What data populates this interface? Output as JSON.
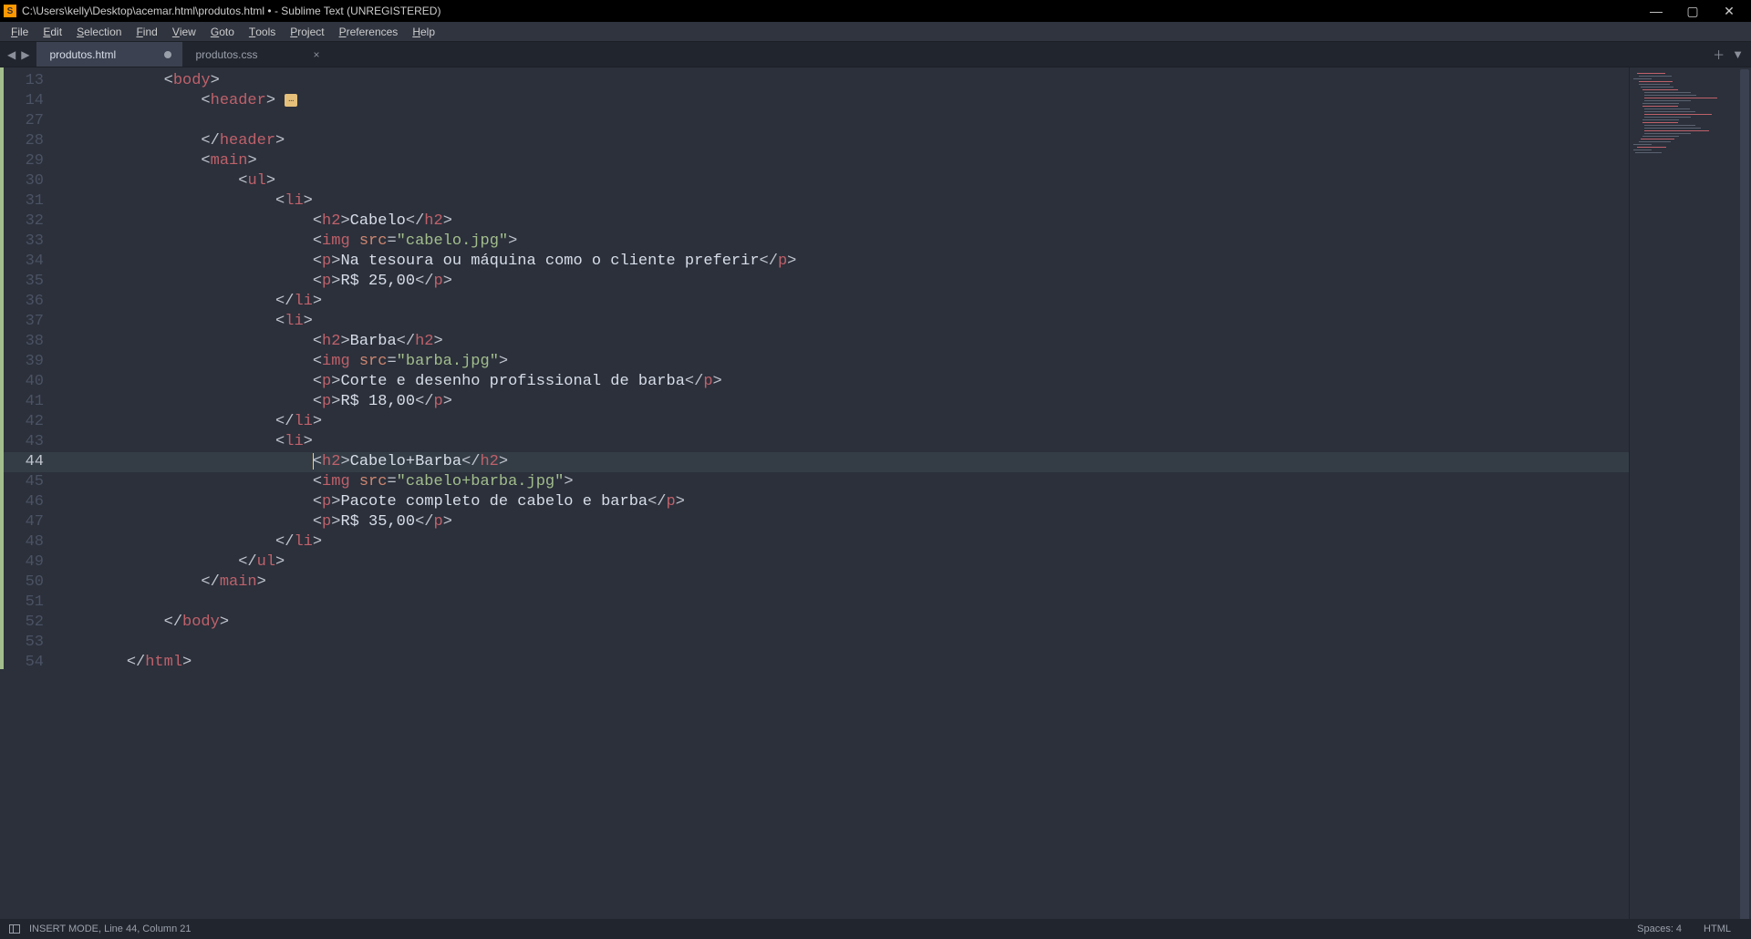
{
  "window": {
    "title": "C:\\Users\\kelly\\Desktop\\acemar.html\\produtos.html • - Sublime Text (UNREGISTERED)"
  },
  "menu": {
    "items": [
      "File",
      "Edit",
      "Selection",
      "Find",
      "View",
      "Goto",
      "Tools",
      "Project",
      "Preferences",
      "Help"
    ]
  },
  "tabs": [
    {
      "label": "produtos.html",
      "active": true,
      "dirty": true
    },
    {
      "label": "produtos.css",
      "active": false,
      "dirty": false
    }
  ],
  "status": {
    "mode": "INSERT MODE, Line 44, Column 21",
    "spaces": "Spaces: 4",
    "syntax": "HTML"
  },
  "editor": {
    "fold_marker": "…",
    "lines": [
      {
        "n": 13,
        "indent": 2,
        "tokens": [
          [
            "pun",
            "<"
          ],
          [
            "tag",
            "body"
          ],
          [
            "pun",
            ">"
          ]
        ]
      },
      {
        "n": 14,
        "indent": 3,
        "tokens": [
          [
            "pun",
            "<"
          ],
          [
            "tag",
            "header"
          ],
          [
            "pun",
            ">"
          ],
          [
            "fold",
            ""
          ]
        ]
      },
      {
        "n": 27,
        "indent": 0,
        "tokens": []
      },
      {
        "n": 28,
        "indent": 3,
        "tokens": [
          [
            "pun",
            "</"
          ],
          [
            "tag",
            "header"
          ],
          [
            "pun",
            ">"
          ]
        ]
      },
      {
        "n": 29,
        "indent": 3,
        "tokens": [
          [
            "pun",
            "<"
          ],
          [
            "tag",
            "main"
          ],
          [
            "pun",
            ">"
          ]
        ]
      },
      {
        "n": 30,
        "indent": 4,
        "tokens": [
          [
            "pun",
            "<"
          ],
          [
            "tag",
            "ul"
          ],
          [
            "pun",
            ">"
          ]
        ]
      },
      {
        "n": 31,
        "indent": 5,
        "tokens": [
          [
            "pun",
            "<"
          ],
          [
            "tag",
            "li"
          ],
          [
            "pun",
            ">"
          ]
        ]
      },
      {
        "n": 32,
        "indent": 6,
        "tokens": [
          [
            "pun",
            "<"
          ],
          [
            "tag",
            "h2"
          ],
          [
            "pun",
            ">"
          ],
          [
            "txt",
            "Cabelo"
          ],
          [
            "pun",
            "</"
          ],
          [
            "tag",
            "h2"
          ],
          [
            "pun",
            ">"
          ]
        ]
      },
      {
        "n": 33,
        "indent": 6,
        "tokens": [
          [
            "pun",
            "<"
          ],
          [
            "tag",
            "img"
          ],
          [
            "txt",
            " "
          ],
          [
            "attr",
            "src"
          ],
          [
            "op",
            "="
          ],
          [
            "str",
            "\"cabelo.jpg\""
          ],
          [
            "pun",
            ">"
          ]
        ]
      },
      {
        "n": 34,
        "indent": 6,
        "tokens": [
          [
            "pun",
            "<"
          ],
          [
            "tag",
            "p"
          ],
          [
            "pun",
            ">"
          ],
          [
            "txt",
            "Na tesoura ou máquina como o cliente preferir"
          ],
          [
            "pun",
            "</"
          ],
          [
            "tag",
            "p"
          ],
          [
            "pun",
            ">"
          ]
        ]
      },
      {
        "n": 35,
        "indent": 6,
        "tokens": [
          [
            "pun",
            "<"
          ],
          [
            "tag",
            "p"
          ],
          [
            "pun",
            ">"
          ],
          [
            "txt",
            "R$ 25,00"
          ],
          [
            "pun",
            "</"
          ],
          [
            "tag",
            "p"
          ],
          [
            "pun",
            ">"
          ]
        ]
      },
      {
        "n": 36,
        "indent": 5,
        "tokens": [
          [
            "pun",
            "</"
          ],
          [
            "tag",
            "li"
          ],
          [
            "pun",
            ">"
          ]
        ]
      },
      {
        "n": 37,
        "indent": 5,
        "tokens": [
          [
            "pun",
            "<"
          ],
          [
            "tag",
            "li"
          ],
          [
            "pun",
            ">"
          ]
        ]
      },
      {
        "n": 38,
        "indent": 6,
        "tokens": [
          [
            "pun",
            "<"
          ],
          [
            "tag",
            "h2"
          ],
          [
            "pun",
            ">"
          ],
          [
            "txt",
            "Barba"
          ],
          [
            "pun",
            "</"
          ],
          [
            "tag",
            "h2"
          ],
          [
            "pun",
            ">"
          ]
        ]
      },
      {
        "n": 39,
        "indent": 6,
        "tokens": [
          [
            "pun",
            "<"
          ],
          [
            "tag",
            "img"
          ],
          [
            "txt",
            " "
          ],
          [
            "attr",
            "src"
          ],
          [
            "op",
            "="
          ],
          [
            "str",
            "\"barba.jpg\""
          ],
          [
            "pun",
            ">"
          ]
        ]
      },
      {
        "n": 40,
        "indent": 6,
        "tokens": [
          [
            "pun",
            "<"
          ],
          [
            "tag",
            "p"
          ],
          [
            "pun",
            ">"
          ],
          [
            "txt",
            "Corte e desenho profissional de barba"
          ],
          [
            "pun",
            "</"
          ],
          [
            "tag",
            "p"
          ],
          [
            "pun",
            ">"
          ]
        ]
      },
      {
        "n": 41,
        "indent": 6,
        "tokens": [
          [
            "pun",
            "<"
          ],
          [
            "tag",
            "p"
          ],
          [
            "pun",
            ">"
          ],
          [
            "txt",
            "R$ 18,00"
          ],
          [
            "pun",
            "</"
          ],
          [
            "tag",
            "p"
          ],
          [
            "pun",
            ">"
          ]
        ]
      },
      {
        "n": 42,
        "indent": 5,
        "tokens": [
          [
            "pun",
            "</"
          ],
          [
            "tag",
            "li"
          ],
          [
            "pun",
            ">"
          ]
        ]
      },
      {
        "n": 43,
        "indent": 5,
        "tokens": [
          [
            "pun",
            "<"
          ],
          [
            "tag",
            "li"
          ],
          [
            "pun",
            ">"
          ]
        ]
      },
      {
        "n": 44,
        "indent": 6,
        "tokens": [
          [
            "caret",
            ""
          ],
          [
            "pun",
            "<"
          ],
          [
            "tag",
            "h2"
          ],
          [
            "pun",
            ">"
          ],
          [
            "txt",
            "Cabelo+Barba"
          ],
          [
            "pun",
            "</"
          ],
          [
            "tag",
            "h2"
          ],
          [
            "pun",
            ">"
          ]
        ],
        "current": true
      },
      {
        "n": 45,
        "indent": 6,
        "tokens": [
          [
            "pun",
            "<"
          ],
          [
            "tag",
            "img"
          ],
          [
            "txt",
            " "
          ],
          [
            "attr",
            "src"
          ],
          [
            "op",
            "="
          ],
          [
            "str",
            "\"cabelo+barba.jpg\""
          ],
          [
            "pun",
            ">"
          ]
        ]
      },
      {
        "n": 46,
        "indent": 6,
        "tokens": [
          [
            "pun",
            "<"
          ],
          [
            "tag",
            "p"
          ],
          [
            "pun",
            ">"
          ],
          [
            "txt",
            "Pacote completo de cabelo e barba"
          ],
          [
            "pun",
            "</"
          ],
          [
            "tag",
            "p"
          ],
          [
            "pun",
            ">"
          ]
        ]
      },
      {
        "n": 47,
        "indent": 6,
        "tokens": [
          [
            "pun",
            "<"
          ],
          [
            "tag",
            "p"
          ],
          [
            "pun",
            ">"
          ],
          [
            "txt",
            "R$ 35,00"
          ],
          [
            "pun",
            "</"
          ],
          [
            "tag",
            "p"
          ],
          [
            "pun",
            ">"
          ]
        ]
      },
      {
        "n": 48,
        "indent": 5,
        "tokens": [
          [
            "pun",
            "</"
          ],
          [
            "tag",
            "li"
          ],
          [
            "pun",
            ">"
          ]
        ]
      },
      {
        "n": 49,
        "indent": 4,
        "tokens": [
          [
            "pun",
            "</"
          ],
          [
            "tag",
            "ul"
          ],
          [
            "pun",
            ">"
          ]
        ]
      },
      {
        "n": 50,
        "indent": 3,
        "tokens": [
          [
            "pun",
            "</"
          ],
          [
            "tag",
            "main"
          ],
          [
            "pun",
            ">"
          ]
        ]
      },
      {
        "n": 51,
        "indent": 0,
        "tokens": []
      },
      {
        "n": 52,
        "indent": 2,
        "tokens": [
          [
            "pun",
            "</"
          ],
          [
            "tag",
            "body"
          ],
          [
            "pun",
            ">"
          ]
        ]
      },
      {
        "n": 53,
        "indent": 0,
        "tokens": []
      },
      {
        "n": 54,
        "indent": 1,
        "tokens": [
          [
            "pun",
            "</"
          ],
          [
            "tag",
            "html"
          ],
          [
            "pun",
            ">"
          ]
        ]
      }
    ]
  }
}
